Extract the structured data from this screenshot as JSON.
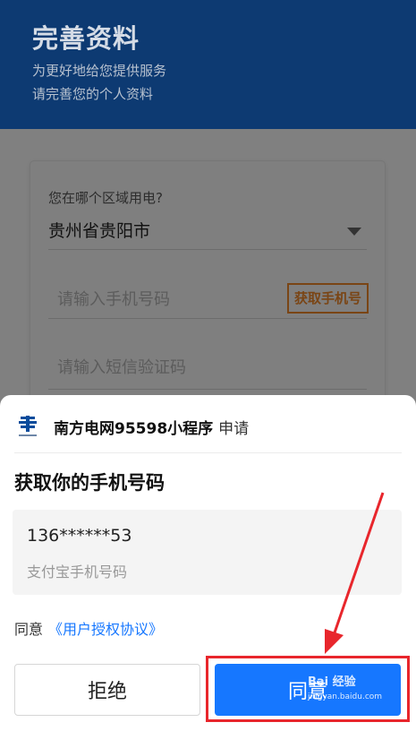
{
  "header": {
    "title": "完善资料",
    "subtitle_line1": "为更好地给您提供服务",
    "subtitle_line2": "请完善您的个人资料"
  },
  "form": {
    "region_label": "您在哪个区域用电?",
    "region_value": "贵州省贵阳市",
    "phone_placeholder": "请输入手机号码",
    "get_code_label": "获取手机号",
    "sms_placeholder": "请输入短信验证码"
  },
  "sheet": {
    "app_name": "南方电网95598小程序",
    "app_apply": "申请",
    "title": "获取你的手机号码",
    "phone_number": "136******53",
    "phone_source": "支付宝手机号码",
    "agree_prefix": "同意",
    "agree_link": "《用户授权协议》",
    "reject_label": "拒绝",
    "agree_label": "同意"
  },
  "watermark": {
    "line1": "Bai 经验",
    "line2": "jingyan.baidu.com"
  },
  "colors": {
    "header_bg": "#0d3a72",
    "primary_blue": "#1677ff",
    "highlight_red": "#e8262c",
    "get_code_border": "#7a4515"
  },
  "icons": {
    "app_logo": "china-southern-power-grid-logo",
    "region_dropdown": "caret-down-icon"
  }
}
